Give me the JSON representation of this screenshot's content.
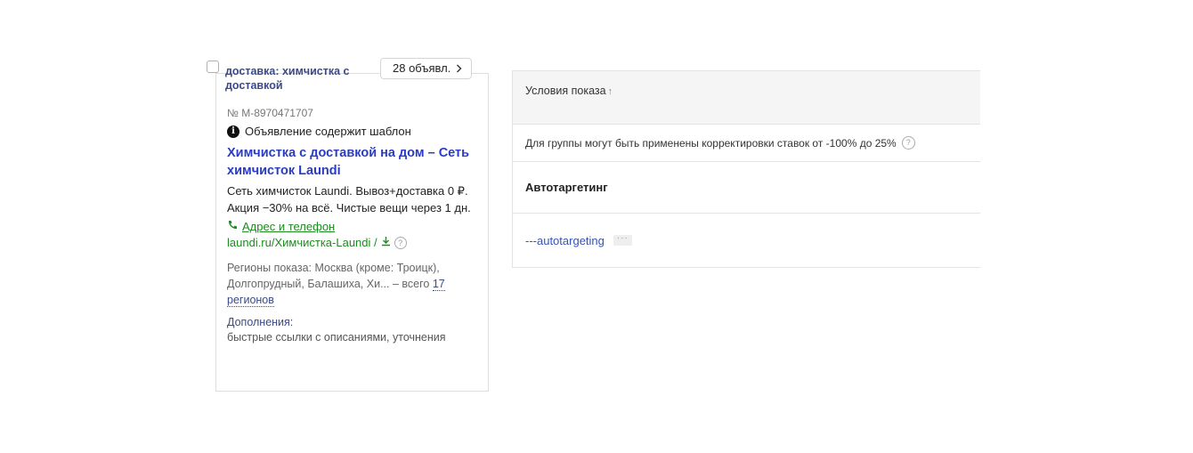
{
  "ad_group": {
    "title": "доставка: химчистка с доставкой",
    "ads_count_label": "28 объявл."
  },
  "ad": {
    "number": "№ М-8970471707",
    "template_notice": "Объявление содержит шаблон",
    "headline": "Химчистка с доставкой на дом – Сеть химчисток Laundi",
    "text": "Сеть химчисток Laundi. Вывоз+доставка 0 ₽. Акция −30% на всё. Чистые вещи через 1 дн.",
    "address_link": "Адрес и телефон",
    "display_url": "laundi.ru/Химчистка-Laundi /",
    "regions_prefix": "Регионы показа: Москва (кроме: Троицк), Долгопрудный, Балашиха, Хи... – всего ",
    "regions_link": "17 регионов",
    "extras_label": "Дополнения:",
    "extras": "быстрые ссылки с описаниями, уточнения"
  },
  "conditions": {
    "header": "Условия показа",
    "sort_icon": "↑",
    "note": "Для группы могут быть применены корректировки ставок от -100% до 25%",
    "autotargeting_title": "Автотаргетинг",
    "autotargeting_item": "---autotargeting",
    "more_label": "···"
  },
  "icons": {
    "info": "i",
    "help": "?",
    "chevron": "chevron-right",
    "phone": "phone",
    "download": "download"
  }
}
